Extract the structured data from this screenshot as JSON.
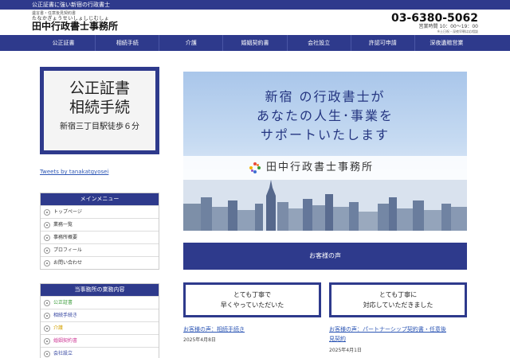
{
  "header": {
    "tagline": "公正証書に強い新宿の行政書士",
    "logo_small": "遺言書・任意後見契約書",
    "logo_kana": "たなかぎょうせいしょしじむしょ",
    "logo_name": "田中行政書士事務所",
    "phone": "03-6380-5062",
    "hours": "営業時間 10：00～19：00",
    "hours_note": "※土日祝・深夜早朝は応相談"
  },
  "nav": {
    "items": [
      "公正証書",
      "相続手続",
      "介護",
      "婚姻契約書",
      "会社設立",
      "許認可申請",
      "深夜遺贈営業"
    ]
  },
  "sidebar": {
    "banner": {
      "line1": "公正証書",
      "line2": "相続手続",
      "line3": "新宿三丁目駅徒歩６分"
    },
    "tweets_link": "Tweets by tanakatgyosei",
    "main_menu": {
      "title": "メインメニュー",
      "items": [
        "トップページ",
        "業務一覧",
        "事務所概要",
        "プロフィール",
        "お問い合わせ"
      ]
    },
    "services_menu": {
      "title": "当事務所の業務内容",
      "items": [
        {
          "label": "公正証書",
          "color": "#3a9b3a"
        },
        {
          "label": "相続手続き",
          "color": "#3344a0"
        },
        {
          "label": "介護",
          "color": "#d4a100"
        },
        {
          "label": "婚姻契約書",
          "color": "#d0409a"
        },
        {
          "label": "会社設立",
          "color": "#3344a0"
        }
      ]
    }
  },
  "hero": {
    "line1": "新宿 の行政書士が",
    "line2": "あなたの人生･事業を",
    "line3": "サポートいたします",
    "logo_text": "田中行政書士事務所"
  },
  "voices": {
    "title": "お客様の声",
    "cards": [
      {
        "line1": "とても丁寧で",
        "line2": "早くやっていただいた"
      },
      {
        "line1": "とても丁寧に",
        "line2": "対応していただきました"
      }
    ],
    "posts": [
      {
        "title": "お客様の声：相続手続き",
        "date": "2025年4月8日"
      },
      {
        "title_line1": "お客様の声：パートナーシップ契約書・任意後",
        "title_line2": "見契約",
        "date": "2025年4月1日"
      }
    ]
  },
  "colors": {
    "brand": "#2e3a8c",
    "link": "#2e57b5"
  }
}
